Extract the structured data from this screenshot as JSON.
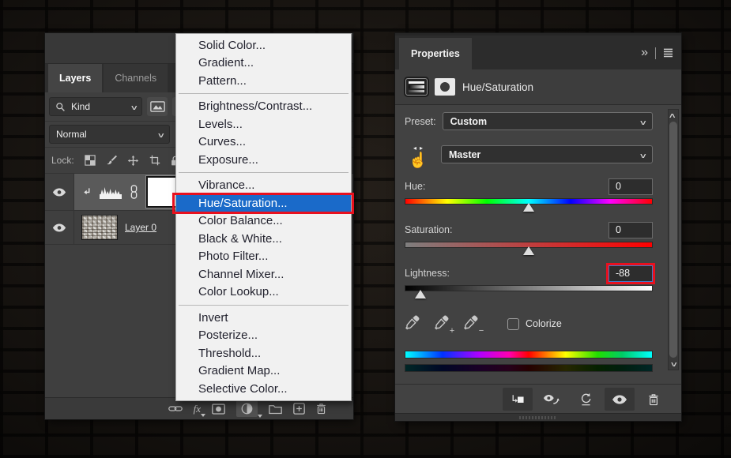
{
  "colors": {
    "annotation_red": "#e8101e",
    "menu_highlight_blue": "#1a6ac9",
    "panel_gray": "#424242"
  },
  "icons": {
    "search": "magnifier",
    "filter_pixel": "image-frame",
    "filter_adjustment": "half-circle",
    "lock_row": [
      "checkerboard",
      "brush",
      "move-cross",
      "artboard-frame",
      "padlock"
    ],
    "layer_toolbar": [
      "chain-link",
      "fx",
      "mask",
      "half-circle",
      "folder",
      "plus-square",
      "trash"
    ],
    "properties_toolbar": [
      "clip-to-layer",
      "eye-previous-state",
      "reset-arrow",
      "eye",
      "trash"
    ],
    "panel_header": [
      "double-chevron-collapse",
      "burger-menu"
    ]
  },
  "layers_panel": {
    "tabs": [
      {
        "label": "Layers",
        "active": true
      },
      {
        "label": "Channels",
        "active": false
      }
    ],
    "filter_kind": "Kind",
    "blend_mode": "Normal",
    "lock_label": "Lock:",
    "layer_row_label": "Layer 0"
  },
  "adjustment_menu": {
    "items": [
      {
        "type": "item",
        "label": "Solid Color..."
      },
      {
        "type": "item",
        "label": "Gradient..."
      },
      {
        "type": "item",
        "label": "Pattern..."
      },
      {
        "type": "separator"
      },
      {
        "type": "item",
        "label": "Brightness/Contrast..."
      },
      {
        "type": "item",
        "label": "Levels..."
      },
      {
        "type": "item",
        "label": "Curves..."
      },
      {
        "type": "item",
        "label": "Exposure..."
      },
      {
        "type": "separator"
      },
      {
        "type": "item",
        "label": "Vibrance..."
      },
      {
        "type": "item",
        "label": "Hue/Saturation...",
        "highlighted": true,
        "annotated": true
      },
      {
        "type": "item",
        "label": "Color Balance..."
      },
      {
        "type": "item",
        "label": "Black & White..."
      },
      {
        "type": "item",
        "label": "Photo Filter..."
      },
      {
        "type": "item",
        "label": "Channel Mixer..."
      },
      {
        "type": "item",
        "label": "Color Lookup..."
      },
      {
        "type": "separator"
      },
      {
        "type": "item",
        "label": "Invert"
      },
      {
        "type": "item",
        "label": "Posterize..."
      },
      {
        "type": "item",
        "label": "Threshold..."
      },
      {
        "type": "item",
        "label": "Gradient Map..."
      },
      {
        "type": "item",
        "label": "Selective Color..."
      }
    ]
  },
  "properties_panel": {
    "tab_label": "Properties",
    "adjustment_title": "Hue/Saturation",
    "preset_label": "Preset:",
    "preset_value": "Custom",
    "channel_value": "Master",
    "sliders": [
      {
        "label": "Hue:",
        "value": "0",
        "position_pct": 50
      },
      {
        "label": "Saturation:",
        "value": "0",
        "position_pct": 50
      },
      {
        "label": "Lightness:",
        "value": "-88",
        "position_pct": 6,
        "annotated": true
      }
    ],
    "colorize_label": "Colorize"
  }
}
